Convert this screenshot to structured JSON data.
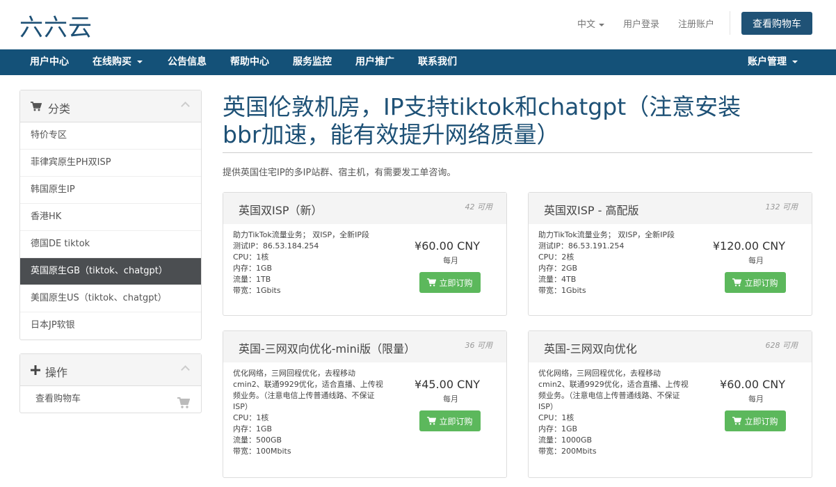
{
  "header": {
    "logo": "六六云",
    "language": "中文",
    "login": "用户登录",
    "register": "注册账户",
    "view_cart": "查看购物车"
  },
  "nav": {
    "items": [
      {
        "label": "用户中心"
      },
      {
        "label": "在线购买",
        "dropdown": true
      },
      {
        "label": "公告信息"
      },
      {
        "label": "帮助中心"
      },
      {
        "label": "服务监控"
      },
      {
        "label": "用户推广"
      },
      {
        "label": "联系我们"
      }
    ],
    "account": "账户管理"
  },
  "sidebar": {
    "categories_title": "分类",
    "categories_icon": "cart-icon",
    "categories": [
      {
        "label": "特价专区"
      },
      {
        "label": "菲律宾原生PH双ISP"
      },
      {
        "label": "韩国原生IP"
      },
      {
        "label": "香港HK"
      },
      {
        "label": "德国DE tiktok"
      },
      {
        "label": "英国原生GB（tiktok、chatgpt）",
        "active": true
      },
      {
        "label": "美国原生US（tiktok、chatgpt）"
      },
      {
        "label": "日本JP软银"
      }
    ],
    "actions_title": "操作",
    "actions_icon": "plus-icon",
    "actions": [
      {
        "label": "查看购物车",
        "icon": "cart-icon"
      }
    ]
  },
  "main": {
    "title_line1": "英国伦敦机房，IP支持tiktok和chatgpt（注意安装",
    "title_line2": "bbr加速，能有效提升网络质量）",
    "tagline": "提供英国住宅IP的多IP站群、宿主机，有需要发工单咨询。",
    "order_label": "立即订购",
    "products": [
      {
        "name": "英国双ISP（新）",
        "available": "42 可用",
        "desc": [
          "助力TikTok流量业务； 双ISP，全新IP段",
          "测试IP：86.53.184.254",
          "CPU：1核",
          "内存：1GB",
          "流量：1TB",
          "带宽：1Gbits"
        ],
        "price": "¥60.00 CNY",
        "cycle": "每月"
      },
      {
        "name": "英国双ISP - 高配版",
        "available": "132 可用",
        "desc": [
          "助力TikTok流量业务； 双ISP，全新IP段",
          "测试IP：86.53.191.254",
          "CPU：2核",
          "内存：2GB",
          "流量：4TB",
          "带宽：1Gbits"
        ],
        "price": "¥120.00 CNY",
        "cycle": "每月"
      },
      {
        "name": "英国-三网双向优化-mini版（限量）",
        "available": "36 可用",
        "desc": [
          "优化网络，三网回程优化，去程移动",
          "cmin2、联通9929优化，适合直播、上传视",
          "频业务。（注意电信上传普通线路、不保证",
          "ISP）",
          "CPU：1核",
          "内存：1GB",
          "流量：500GB",
          "带宽：100Mbits"
        ],
        "price": "¥45.00 CNY",
        "cycle": "每月"
      },
      {
        "name": "英国-三网双向优化",
        "available": "628 可用",
        "desc": [
          "优化网络，三网回程优化，去程移动",
          "cmin2、联通9929优化，适合直播、上传视",
          "频业务。（注意电信上传普通线路、不保证",
          "ISP）",
          "CPU：1核",
          "内存：1GB",
          "流量：1000GB",
          "带宽：200Mbits"
        ],
        "price": "¥60.00 CNY",
        "cycle": "每月"
      }
    ]
  },
  "colors": {
    "brand": "#1e5176",
    "navbar": "#145178",
    "active_category": "#4b4e51",
    "order_button": "#5cb85c"
  }
}
